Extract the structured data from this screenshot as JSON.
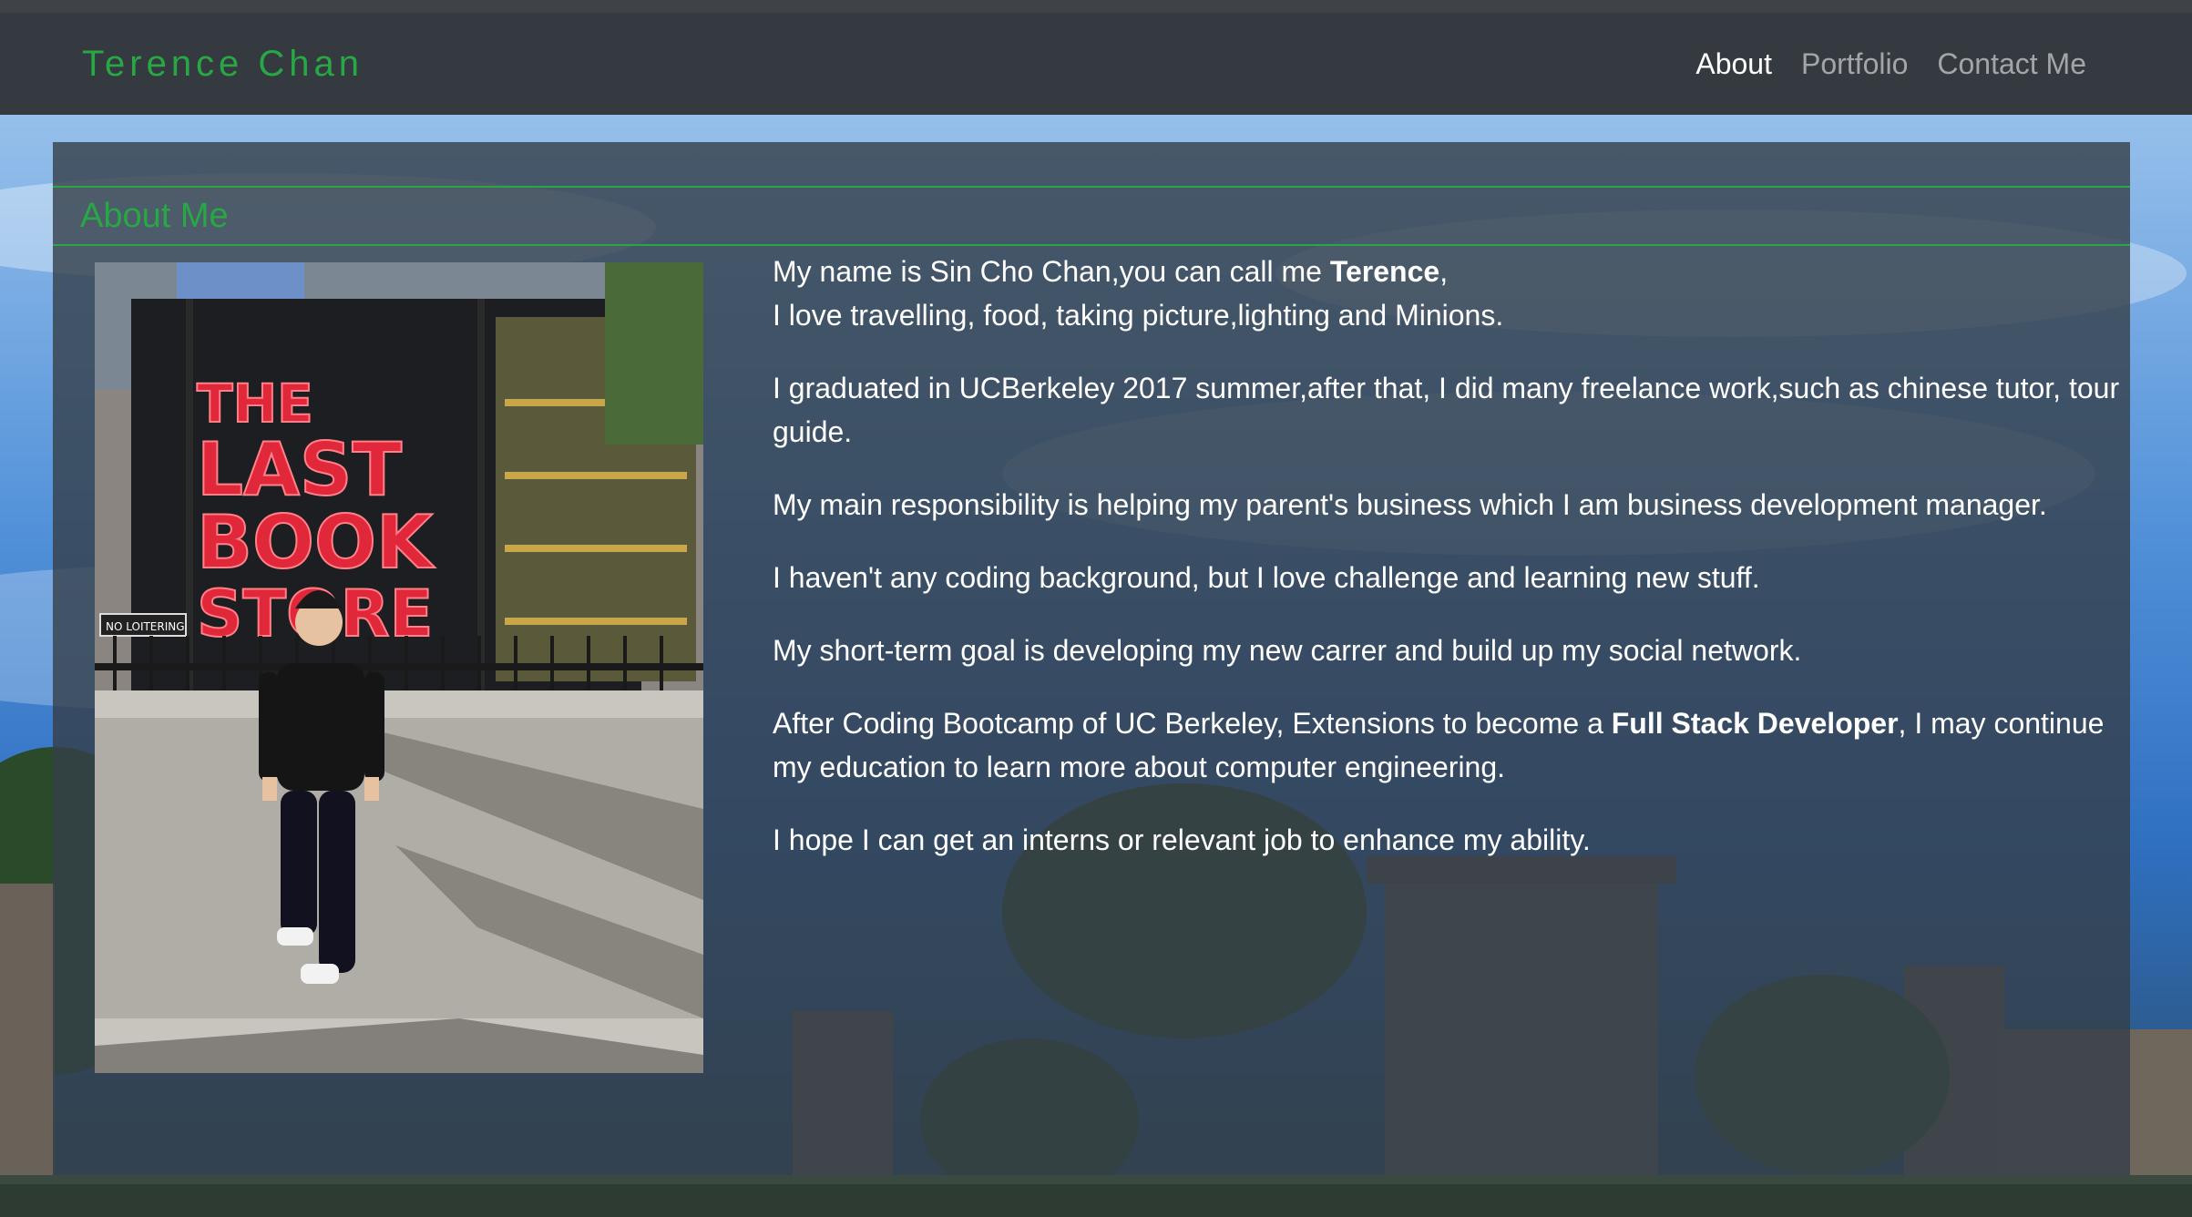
{
  "navbar": {
    "brand": "Terence Chan",
    "links": [
      "About",
      "Portfolio",
      "Contact Me"
    ],
    "active": "About"
  },
  "about": {
    "title": "About Me",
    "photo": {
      "sign_lines": [
        "THE",
        "LAST",
        "BOOK",
        "STORE"
      ],
      "small_sign": "NO LOITERING"
    },
    "p1_line1_pre": "My name is Sin Cho Chan,you can call me ",
    "p1_line1_bold": "Terence",
    "p1_line1_post": ",",
    "p1_line2": "I love travelling, food, taking picture,lighting and Minions.",
    "p2": "I graduated in UCBerkeley 2017 summer,after that, I did many freelance work,such as chinese tutor, tour guide.",
    "p3": "My main responsibility is helping my parent's business which I am business development manager.",
    "p4": "I haven't any coding background, but I love challenge and learning new stuff.",
    "p5": "My short-term goal is developing my new carrer and build up my social network.",
    "p6_pre": "After Coding Bootcamp of UC Berkeley, Extensions to become a ",
    "p6_bold": "Full Stack Developer",
    "p6_post": ", I may continue my education to learn more about computer engineering.",
    "p7": "I hope I can get an interns or relevant job to enhance my ability."
  },
  "colors": {
    "accent": "#28a745",
    "navbar_bg": "#343a40",
    "panel_bg": "#343e48"
  }
}
